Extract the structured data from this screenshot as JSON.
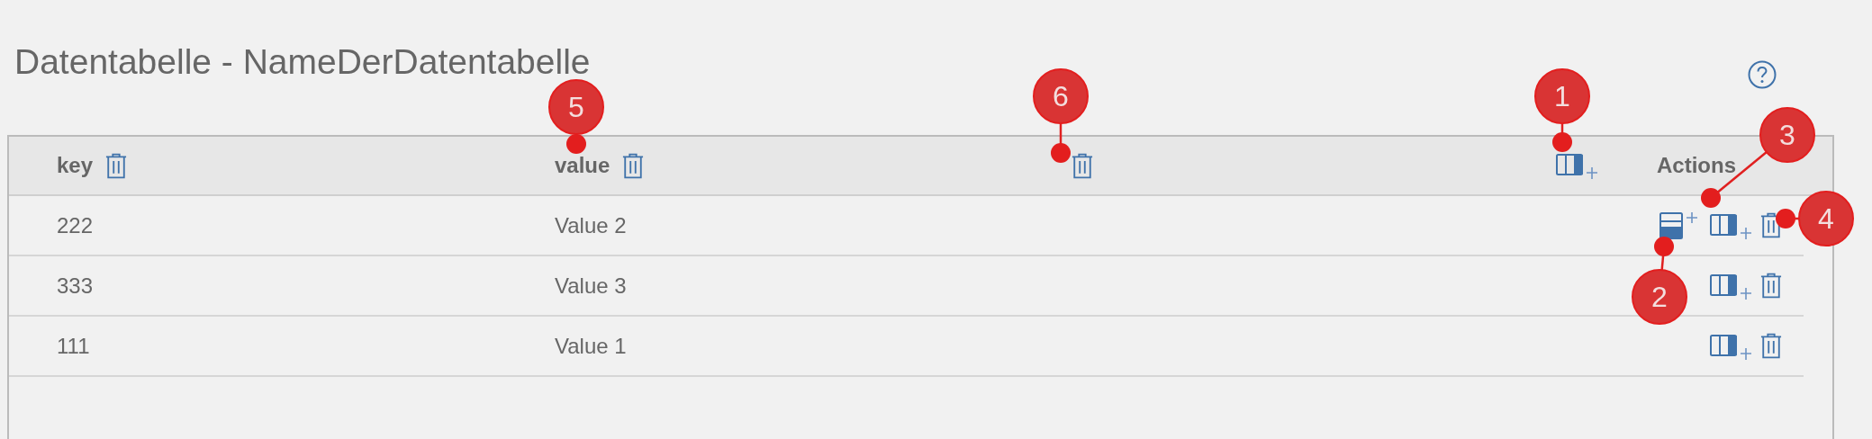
{
  "title": "Datentabelle - NameDerDatentabelle",
  "table": {
    "columns": [
      {
        "kind": "data",
        "label": "key"
      },
      {
        "kind": "data",
        "label": "value"
      },
      {
        "kind": "data"
      }
    ],
    "actions_label": "Actions",
    "rows": [
      {
        "cells": [
          "222",
          "Value 2"
        ],
        "row_insert": true
      },
      {
        "cells": [
          "333",
          "Value 3"
        ],
        "row_insert": false
      },
      {
        "cells": [
          "111",
          "Value 1"
        ],
        "row_insert": false
      }
    ]
  },
  "callouts": [
    {
      "number": "1"
    },
    {
      "number": "2"
    },
    {
      "number": "3"
    },
    {
      "number": "4"
    },
    {
      "number": "5"
    },
    {
      "number": "6"
    }
  ]
}
